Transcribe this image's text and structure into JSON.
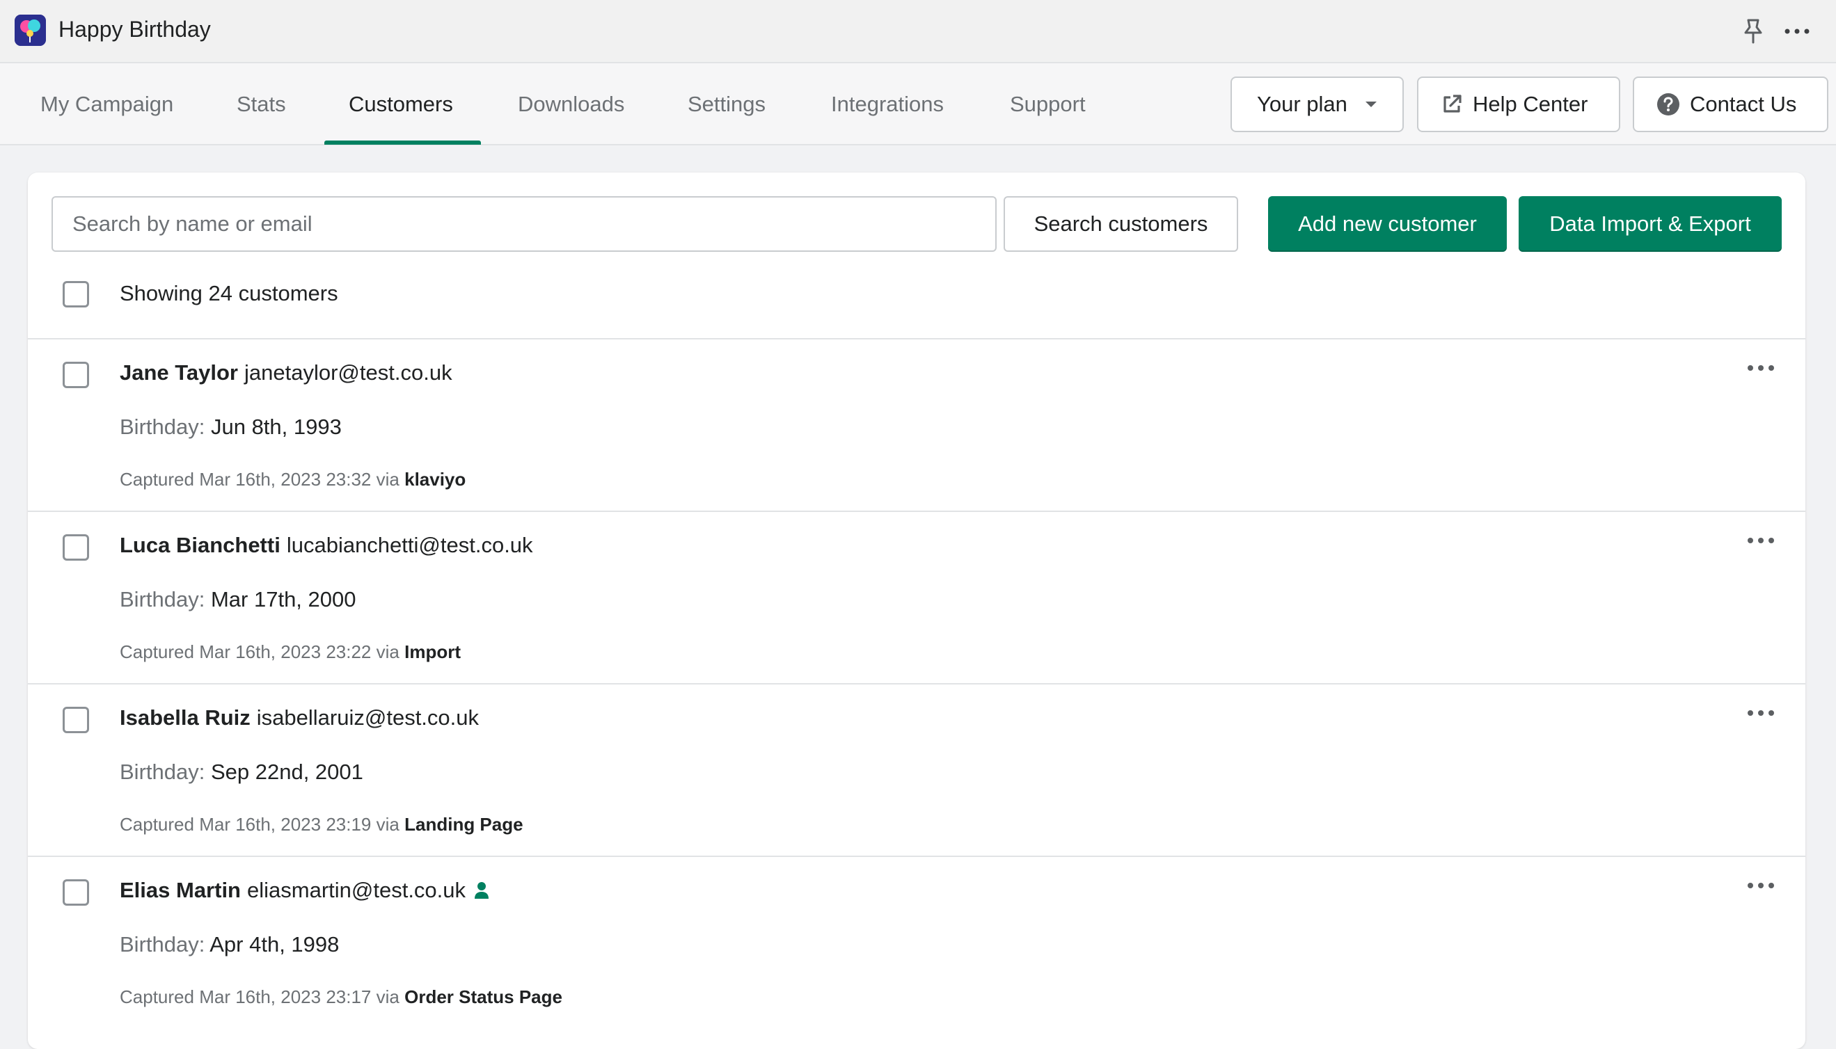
{
  "app": {
    "title": "Happy Birthday"
  },
  "nav": {
    "tabs": [
      {
        "label": "My Campaign"
      },
      {
        "label": "Stats"
      },
      {
        "label": "Customers"
      },
      {
        "label": "Downloads"
      },
      {
        "label": "Settings"
      },
      {
        "label": "Integrations"
      },
      {
        "label": "Support"
      }
    ],
    "active_tab": "Customers",
    "your_plan_label": "Your plan",
    "help_center_label": "Help Center",
    "contact_us_label": "Contact Us"
  },
  "toolbar": {
    "search_placeholder": "Search by name or email",
    "search_value": "",
    "search_button_label": "Search customers",
    "add_button_label": "Add new customer",
    "import_export_button_label": "Data Import & Export"
  },
  "list": {
    "showing_label": "Showing 24 customers",
    "birthday_label": "Birthday:",
    "captured_prefix": "Captured",
    "via_label": "via",
    "customers": [
      {
        "name": "Jane Taylor",
        "email": "janetaylor@test.co.uk",
        "birthday": "Jun 8th, 1993",
        "captured": "Mar 16th, 2023 23:32",
        "source": "klaviyo",
        "has_account": false
      },
      {
        "name": "Luca Bianchetti",
        "email": "lucabianchetti@test.co.uk",
        "birthday": "Mar 17th, 2000",
        "captured": "Mar 16th, 2023 23:22",
        "source": "Import",
        "has_account": false
      },
      {
        "name": "Isabella Ruiz",
        "email": "isabellaruiz@test.co.uk",
        "birthday": "Sep 22nd, 2001",
        "captured": "Mar 16th, 2023 23:19",
        "source": "Landing Page",
        "has_account": false
      },
      {
        "name": "Elias Martin",
        "email": "eliasmartin@test.co.uk",
        "birthday": "Apr 4th, 1998",
        "captured": "Mar 16th, 2023 23:17",
        "source": "Order Status Page",
        "has_account": true
      }
    ]
  },
  "colors": {
    "accent": "#008060",
    "text": "#202223",
    "subdued": "#6d7175",
    "border": "#c9cccf"
  },
  "icons": {
    "logo": "app-logo-icon",
    "pin": "pin-icon",
    "more": "more-horizontal-icon",
    "dropdown": "caret-down-icon",
    "external": "external-link-icon",
    "help": "question-circle-icon",
    "person": "person-icon"
  }
}
